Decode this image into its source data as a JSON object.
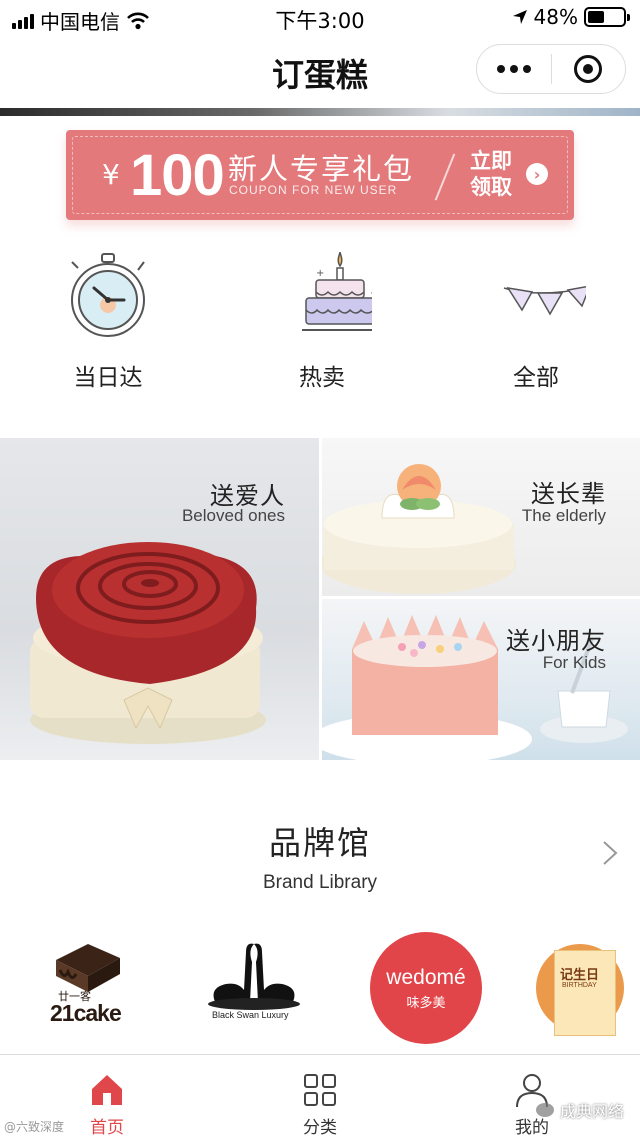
{
  "status_bar": {
    "carrier": "中国电信",
    "time": "下午3:00",
    "battery": "48%",
    "battery_level": 0.48,
    "icons": [
      "signal-icon",
      "wifi-icon",
      "location-arrow-icon",
      "battery-icon"
    ]
  },
  "nav": {
    "title": "订蛋糕",
    "menu_icon": "more-dots-icon",
    "close_icon": "target-icon"
  },
  "coupon": {
    "currency": "¥",
    "amount": "100",
    "title": "新人专享礼包",
    "subtitle": "COUPON FOR NEW USER",
    "cta": "立即领取",
    "arrow": "›"
  },
  "categories": [
    {
      "label": "当日达",
      "icon": "clock-icon"
    },
    {
      "label": "热卖",
      "icon": "birthday-cake-icon"
    },
    {
      "label": "全部",
      "icon": "bunting-flags-icon"
    }
  ],
  "occasions": {
    "lover": {
      "zh": "送爱人",
      "en": "Beloved ones"
    },
    "elder": {
      "zh": "送长辈",
      "en": "The elderly"
    },
    "kids": {
      "zh": "送小朋友",
      "en": "For Kids"
    }
  },
  "brands": {
    "title": "品牌馆",
    "subtitle": "Brand Library",
    "chevron": "chevron-right-icon",
    "items": [
      {
        "name": "21cake",
        "cn": "廿一客"
      },
      {
        "name": "Black Swan Luxury"
      },
      {
        "name": "wedomé",
        "cn": "味多美"
      },
      {
        "name": "记生日",
        "en": "BIRTHDAY"
      }
    ],
    "colors": {
      "wedome": "#e14549",
      "jsr": "#eb9a4b"
    }
  },
  "tab_bar": {
    "items": [
      {
        "label": "首页",
        "icon": "home-icon",
        "active": true
      },
      {
        "label": "分类",
        "icon": "grid-icon",
        "active": false
      },
      {
        "label": "我的",
        "icon": "user-icon",
        "active": false
      }
    ],
    "active_color": "#e0474a"
  },
  "watermarks": {
    "left": "@六致深度",
    "right": "成典网络"
  },
  "colors": {
    "coupon_bg": "#e3797b",
    "accent": "#e0474a"
  }
}
